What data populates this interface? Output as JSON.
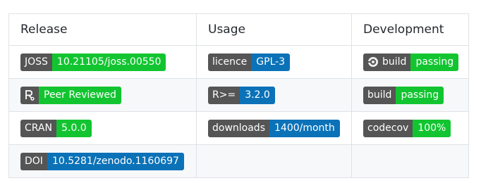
{
  "headers": {
    "release": "Release",
    "usage": "Usage",
    "development": "Development"
  },
  "row1": {
    "joss": {
      "label": "JOSS",
      "value": "10.21105/joss.00550"
    },
    "licence": {
      "label": "licence",
      "value": "GPL-3"
    },
    "build_ci": {
      "label": "build",
      "value": "passing",
      "icon": "circleci-icon"
    }
  },
  "row2": {
    "peer": {
      "value": "Peer Reviewed",
      "icon": "ropensci-icon"
    },
    "rversion": {
      "label": "R>=",
      "value": "3.2.0"
    },
    "build": {
      "label": "build",
      "value": "passing"
    }
  },
  "row3": {
    "cran": {
      "label": "CRAN",
      "value": "5.0.0"
    },
    "downloads": {
      "label": "downloads",
      "value": "1400/month"
    },
    "codecov": {
      "label": "codecov",
      "value": "100%"
    }
  },
  "row4": {
    "doi": {
      "label": "DOI",
      "value": "10.5281/zenodo.1160697"
    }
  },
  "colors": {
    "label_bg": "#555555",
    "green": "#12c530",
    "blue": "#0b72b8",
    "border": "#dfe2e5",
    "stripe": "#f6f8fa"
  }
}
